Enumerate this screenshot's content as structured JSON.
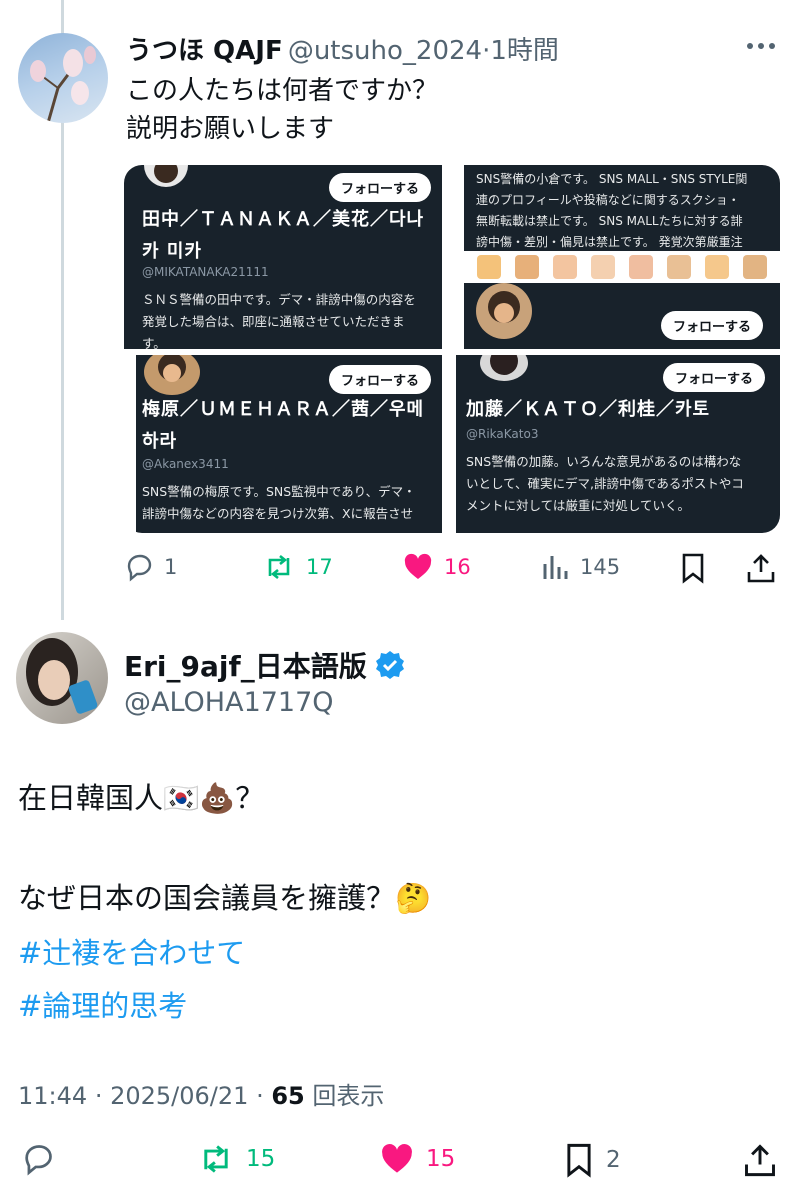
{
  "reply_tweet": {
    "author_name": "うつほ QAJF",
    "handle": "@utsuho_2024",
    "separator": "·",
    "time": "1時間",
    "text_line1": "この人たちは何者ですか？",
    "text_line2": "説明お願いします",
    "media": {
      "cards": [
        {
          "follow": "フォローする",
          "name_line1": "田中／ＴＡＮＡＫＡ／美花／다나",
          "name_line2": "카 미카",
          "handle": "@MIKATANAKA21111",
          "bio_line1": "ＳＮＳ警備の田中です。デマ・誹謗中傷の内容を",
          "bio_line2": "発覚した場合は、即座に通報させていただきま",
          "bio_line3": "す。"
        },
        {
          "follow": "フォローする",
          "bio_line1": "SNS警備の小倉です。 SNS MALL・SNS STYLE関",
          "bio_line2": "連のプロフィールや投稿などに関するスクショ・",
          "bio_line3": "無断転載は禁止です。 SNS MALLたちに対する誹",
          "bio_line4": "謗中傷・差別・偏見は禁止です。 発覚次第厳重注"
        },
        {
          "follow": "フォローする",
          "name_line1": "梅原／ＵＭＥＨＡＲＡ／茜／우메",
          "name_line2": "하라",
          "handle": "@Akanex3411",
          "bio_line1": "SNS警備の梅原です。SNS監視中であり、デマ・",
          "bio_line2": "誹謗中傷などの内容を見つけ次第、Xに報告させ"
        },
        {
          "follow": "フォローする",
          "name_line1": "加藤／ＫＡＴＯ／利桂／카토",
          "handle": "@RikaKato3",
          "bio_line1": "SNS警備の加藤。いろんな意見があるのは構わな",
          "bio_line2": "いとして、確実にデマ,誹謗中傷であるポストやコ",
          "bio_line3": "メントに対しては厳重に対処していく。"
        }
      ]
    },
    "actions": {
      "replies": "1",
      "reposts": "17",
      "likes": "16",
      "views": "145"
    }
  },
  "main_tweet": {
    "author_name": "Eri_9ajf_日本語版",
    "handle": "@ALOHA1717Q",
    "line1": "在日韓国人🇰🇷💩？",
    "line2": "なぜ日本の国会議員を擁護？🤔",
    "hashtag1": "#辻褄を合わせて",
    "hashtag2": "#論理的思考",
    "time": "11:44",
    "date": "2025/06/21",
    "dot": "·",
    "views_count": "65",
    "views_label": "回表示",
    "actions": {
      "reposts": "15",
      "likes": "15",
      "bookmarks": "2"
    }
  },
  "colors": {
    "text": "#0f1419",
    "secondary": "#536471",
    "link": "#1d9bf0",
    "retweet": "#00ba7c",
    "like": "#f91880",
    "verified": "#1d9bf0",
    "card_bg": "#18222b"
  }
}
